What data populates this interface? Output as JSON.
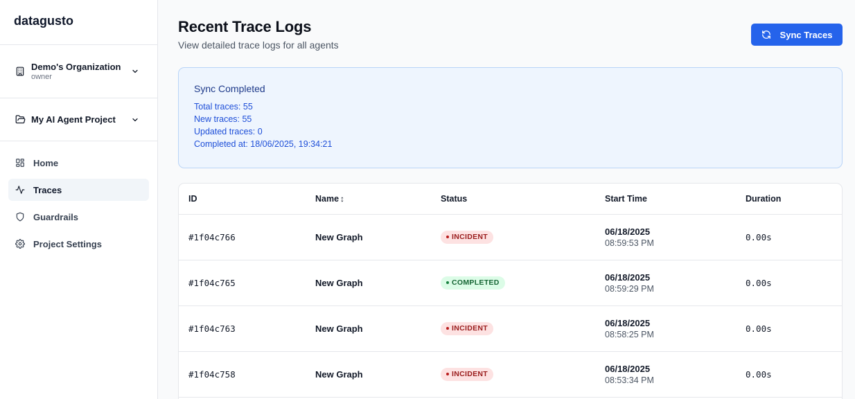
{
  "sidebar": {
    "brand": "datagusto",
    "organization": {
      "name": "Demo's Organization",
      "role": "owner",
      "icon": "building-icon"
    },
    "project": {
      "name": "My AI Agent Project",
      "icon": "folder-icon"
    },
    "nav": [
      {
        "label": "Home",
        "icon": "grid-icon",
        "active": false
      },
      {
        "label": "Traces",
        "icon": "activity-icon",
        "active": true
      },
      {
        "label": "Guardrails",
        "icon": "shield-icon",
        "active": false
      },
      {
        "label": "Project Settings",
        "icon": "gear-icon",
        "active": false
      }
    ]
  },
  "header": {
    "title": "Recent Trace Logs",
    "subtitle": "View detailed trace logs for all agents",
    "sync_button": "Sync Traces"
  },
  "alert": {
    "title": "Sync Completed",
    "lines": [
      "Total traces: 55",
      "New traces: 55",
      "Updated traces: 0",
      "Completed at: 18/06/2025, 19:34:21"
    ]
  },
  "table": {
    "columns": [
      "ID",
      "Name",
      "Status",
      "Start Time",
      "Duration"
    ],
    "rows": [
      {
        "id": "#1f04c766",
        "name": "New Graph",
        "status": "INCIDENT",
        "status_type": "incident",
        "date": "06/18/2025",
        "time": "08:59:53 PM",
        "duration": "0.00s"
      },
      {
        "id": "#1f04c765",
        "name": "New Graph",
        "status": "COMPLETED",
        "status_type": "completed",
        "date": "06/18/2025",
        "time": "08:59:29 PM",
        "duration": "0.00s"
      },
      {
        "id": "#1f04c763",
        "name": "New Graph",
        "status": "INCIDENT",
        "status_type": "incident",
        "date": "06/18/2025",
        "time": "08:58:25 PM",
        "duration": "0.00s"
      },
      {
        "id": "#1f04c758",
        "name": "New Graph",
        "status": "INCIDENT",
        "status_type": "incident",
        "date": "06/18/2025",
        "time": "08:53:34 PM",
        "duration": "0.00s"
      }
    ]
  },
  "colors": {
    "primary": "#2563eb",
    "incident_bg": "#fde2e2",
    "incident_text": "#991b1b",
    "completed_bg": "#dcfce7",
    "completed_text": "#166534",
    "alert_bg": "#eef5fe"
  }
}
